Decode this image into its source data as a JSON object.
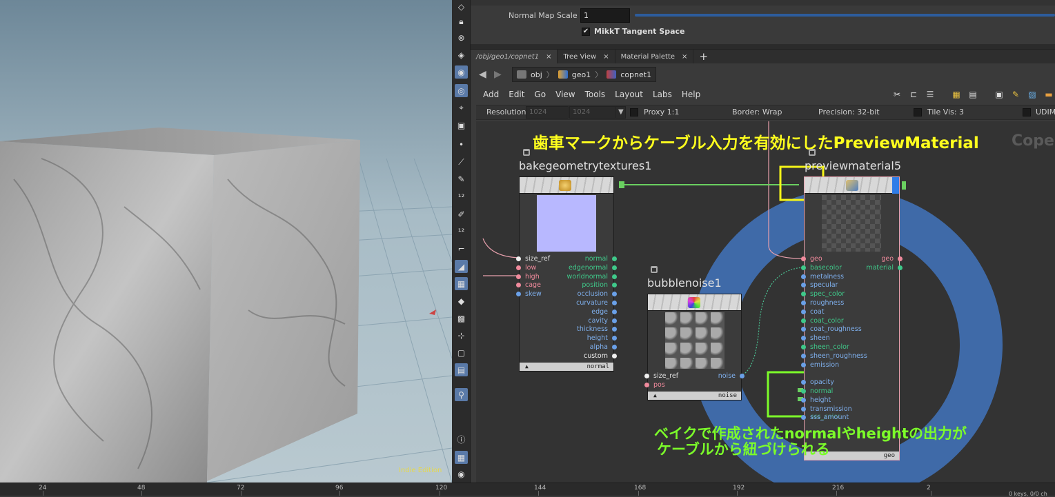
{
  "viewport": {
    "watermark": "Indie Edition"
  },
  "params": {
    "normal_map_scale_label": "Normal Map Scale",
    "normal_map_scale_value": "1",
    "mikkt_label": "MikkT Tangent Space"
  },
  "tabs": [
    {
      "label": "/obj/geo1/copnet1"
    },
    {
      "label": "Tree View"
    },
    {
      "label": "Material Palette"
    }
  ],
  "tab_close": "×",
  "tab_add": "+",
  "breadcrumbs": [
    "obj",
    "geo1",
    "copnet1"
  ],
  "menu": [
    "Add",
    "Edit",
    "Go",
    "View",
    "Tools",
    "Layout",
    "Labs",
    "Help"
  ],
  "options": {
    "resolution_label": "Resolution",
    "res_x": "1024",
    "res_y": "1024",
    "proxy": "Proxy 1:1",
    "border": "Border: Wrap",
    "precision": "Precision: 32-bit",
    "tile_vis": "Tile Vis: 3",
    "udim": "UDIM"
  },
  "annotations": {
    "top": "歯車マークからケーブル入力を有効にしたPreviewMaterial",
    "copernicus_partial": "Coper",
    "bottom_line1": "ベイクで作成されたnormalやheightの出力が",
    "bottom_line2": "ケーブルから紐づけられる"
  },
  "nodes": {
    "bake": {
      "name": "bakegeometrytextures1",
      "footer": "normal",
      "inputs": [
        "size_ref",
        "low",
        "high",
        "cage",
        "skew"
      ],
      "outputs": [
        "normal",
        "edgenormal",
        "worldnormal",
        "position",
        "occlusion",
        "curvature",
        "edge",
        "cavity",
        "thickness",
        "height",
        "alpha",
        "custom"
      ]
    },
    "noise": {
      "name": "bubblenoise1",
      "footer": "noise",
      "inputs": [
        "size_ref",
        "pos"
      ],
      "outputs": [
        "noise"
      ]
    },
    "preview": {
      "name": "previewmaterial5",
      "footer": "geo",
      "inputs": [
        "geo",
        "basecolor",
        "metalness",
        "specular",
        "spec_color",
        "roughness",
        "coat",
        "coat_color",
        "coat_roughness",
        "sheen",
        "sheen_color",
        "sheen_roughness",
        "emission",
        "opacity",
        "normal",
        "height",
        "transmission",
        "sss_amount"
      ],
      "outputs": [
        "geo",
        "material"
      ],
      "hidden_partial": [
        "sss_color"
      ]
    }
  },
  "timeline": {
    "ticks": [
      "24",
      "48",
      "72",
      "96",
      "120",
      "144",
      "168",
      "192",
      "216",
      "2"
    ],
    "status": "0 keys, 0/0 ch"
  },
  "colors": {
    "ann_yellow": "#ffff1e",
    "ann_green": "#7cfc2a",
    "circle_blue": "#3f6aa8",
    "port_blue": "#6aa0e8",
    "port_green": "#3fc98a",
    "port_pink": "#f08a9c",
    "port_white": "#f0f0f0"
  }
}
